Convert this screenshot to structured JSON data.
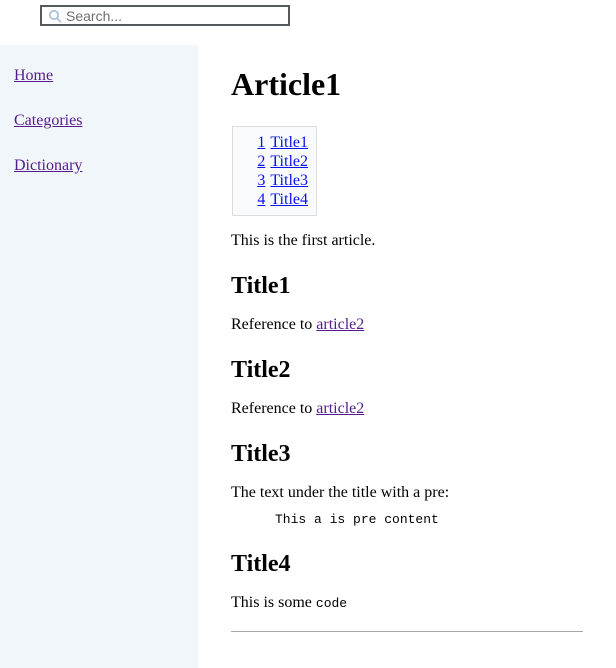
{
  "search": {
    "placeholder": "Search...",
    "value": "",
    "icon": "search-icon"
  },
  "sidebar": {
    "items": [
      {
        "label": "Home"
      },
      {
        "label": "Categories"
      },
      {
        "label": "Dictionary"
      }
    ]
  },
  "article": {
    "title": "Article1",
    "toc": [
      {
        "num": "1",
        "label": "Title1"
      },
      {
        "num": "2",
        "label": "Title2"
      },
      {
        "num": "3",
        "label": "Title3"
      },
      {
        "num": "4",
        "label": "Title4"
      }
    ],
    "intro": "This is the first article.",
    "sections": [
      {
        "heading": "Title1",
        "text_before": "Reference to ",
        "link": "article2",
        "text_after": ""
      },
      {
        "heading": "Title2",
        "text_before": "Reference to ",
        "link": "article2",
        "text_after": ""
      },
      {
        "heading": "Title3",
        "text_before": "The text under the title with a pre:",
        "pre": "This a is pre content"
      },
      {
        "heading": "Title4",
        "text_before": "This is some ",
        "code": "code"
      }
    ]
  },
  "colors": {
    "sidebar_bg": "#f1f6fb",
    "visited_link": "#551a8b",
    "toc_link": "#0b12ee",
    "toc_bg": "#f8fafc",
    "toc_border": "#dcdcdc",
    "search_border": "#555a5e"
  }
}
